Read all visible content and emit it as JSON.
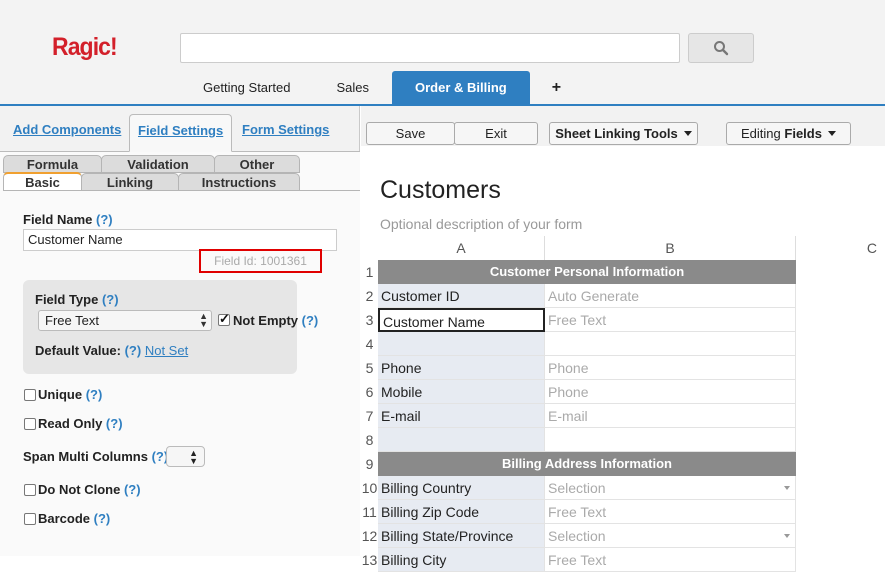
{
  "header": {
    "logo": "Ragic!",
    "search": {
      "placeholder": ""
    },
    "tabs": [
      "Getting Started",
      "Sales",
      "Order & Billing",
      "+"
    ],
    "active_tab": "Order & Billing"
  },
  "left_panel": {
    "tabs": [
      "Add Components",
      "Field Settings",
      "Form Settings"
    ],
    "active_tab": "Field Settings",
    "subtabs_row1": [
      "Formula",
      "Validation",
      "Other"
    ],
    "subtabs_row2": [
      "Basic",
      "Linking",
      "Instructions"
    ],
    "active_subtab": "Basic",
    "field_name_label": "Field Name",
    "help": "(?)",
    "field_name_value": "Customer Name",
    "field_id": "Field Id: 1001361",
    "field_type_label": "Field Type",
    "field_type_value": "Free Text",
    "not_empty_label": "Not Empty",
    "default_value_label": "Default Value:",
    "default_value_link": "Not Set",
    "options": [
      "Unique",
      "Read Only",
      "Span Multi Columns",
      "Do Not Clone",
      "Barcode"
    ]
  },
  "toolbar": {
    "save": "Save",
    "exit": "Exit",
    "sheet_linking": "Sheet Linking Tools",
    "editing_prefix": "Editing",
    "editing_bold": "Fields"
  },
  "form": {
    "title": "Customers",
    "description": "Optional description of your form",
    "columns": [
      "A",
      "B",
      "C"
    ],
    "rows": [
      {
        "num": "1",
        "section": "Customer Personal Information"
      },
      {
        "num": "2",
        "a": "Customer ID",
        "b": "Auto Generate"
      },
      {
        "num": "3",
        "a": "Customer Name",
        "b": "Free Text"
      },
      {
        "num": "4",
        "a": "",
        "b": ""
      },
      {
        "num": "5",
        "a": "Phone",
        "b": "Phone"
      },
      {
        "num": "6",
        "a": "Mobile",
        "b": "Phone"
      },
      {
        "num": "7",
        "a": "E-mail",
        "b": "E-mail"
      },
      {
        "num": "8",
        "a": "",
        "b": ""
      },
      {
        "num": "9",
        "section": "Billing Address Information"
      },
      {
        "num": "10",
        "a": "Billing Country",
        "b": "Selection"
      },
      {
        "num": "11",
        "a": "Billing Zip Code",
        "b": "Free Text"
      },
      {
        "num": "12",
        "a": "Billing State/Province",
        "b": "Selection"
      },
      {
        "num": "13",
        "a": "Billing City",
        "b": "Free Text"
      }
    ]
  },
  "colors": {
    "accent": "#2f7fc1",
    "logo": "#d3202a",
    "highlight": "#e00000"
  }
}
